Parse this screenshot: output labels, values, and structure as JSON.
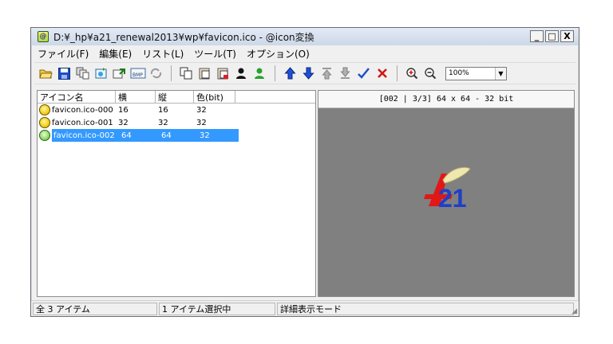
{
  "window": {
    "title": "D:¥_hp¥a21_renewal2013¥wp¥favicon.ico - @icon変換",
    "app_icon_glyph": "@",
    "minimize": "_",
    "maximize": "□",
    "close": "X"
  },
  "menu": [
    {
      "label": "ファイル(F)",
      "icon": ""
    },
    {
      "label": "編集(E)",
      "icon": ""
    },
    {
      "label": "リスト(L)",
      "icon": ""
    },
    {
      "label": "ツール(T)",
      "icon": ""
    },
    {
      "label": "オプション(O)",
      "icon": ""
    }
  ],
  "toolbar": {
    "buttons": [
      "open-folder-icon",
      "save-icon",
      "copy-multi-icon",
      "add-image-icon",
      "export-icon",
      "bmp-icon",
      "refresh-icon",
      "copy-icon",
      "paste-icon",
      "paste-special-icon",
      "user-dark-icon",
      "user-green-icon",
      "move-up-icon",
      "move-down-icon",
      "move-top-icon",
      "move-bottom-icon",
      "check-icon",
      "delete-icon",
      "zoom-in-icon",
      "zoom-out-icon"
    ],
    "zoom_value": "100%",
    "bmp_label": "BMP"
  },
  "list": {
    "columns": [
      "アイコン名",
      "横",
      "縦",
      "色(bit)"
    ],
    "rows": [
      {
        "name": "favicon.ico-000",
        "w": "16",
        "h": "16",
        "bits": "32",
        "icon": "smile-yellow",
        "selected": false
      },
      {
        "name": "favicon.ico-001",
        "w": "32",
        "h": "32",
        "bits": "32",
        "icon": "smile-yellow",
        "selected": false
      },
      {
        "name": "favicon.ico-002",
        "w": "64",
        "h": "64",
        "bits": "32",
        "icon": "smile-green",
        "selected": true
      }
    ]
  },
  "preview": {
    "header": "[002 | 3/3] 64 x 64 - 32 bit",
    "logo_text": "21",
    "logo_letter": "A",
    "colors": {
      "background": "#808080",
      "logo_blue": "#1f3fc8",
      "logo_red": "#e01818"
    }
  },
  "status": {
    "total": "全 3 アイテム",
    "selected": "1 アイテム選択中",
    "mode": "詳細表示モード"
  },
  "colors": {
    "selection": "#3399ff"
  }
}
